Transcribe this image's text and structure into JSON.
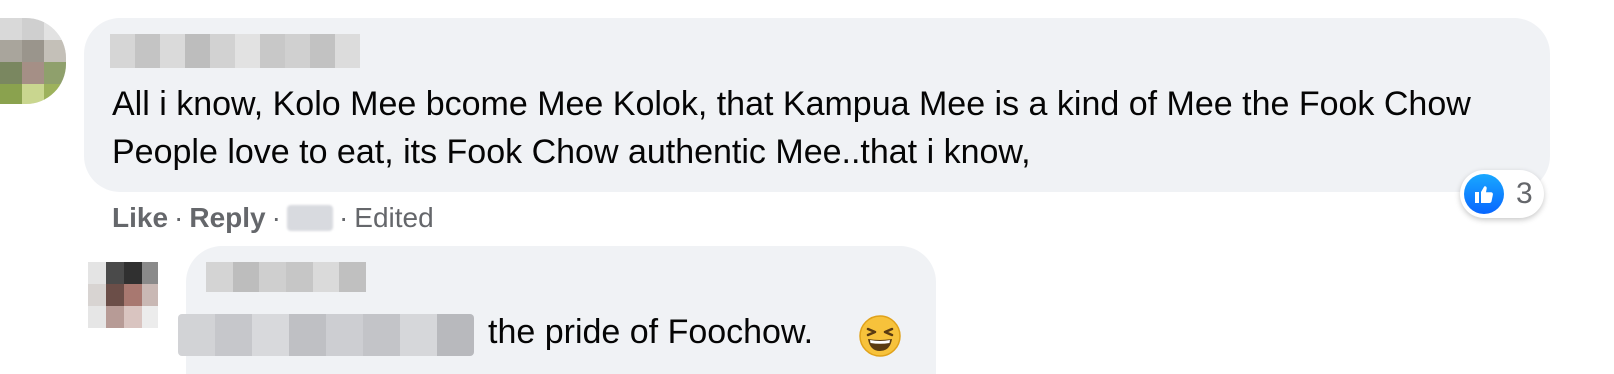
{
  "comment": {
    "text": "All i know, Kolo Mee bcome Mee Kolok, that Kampua Mee is a kind of Mee the Fook Chow People love to eat, its Fook Chow authentic Mee..that i know,",
    "actions": {
      "like": "Like",
      "reply": "Reply",
      "edited": "Edited"
    },
    "reaction": {
      "icon": "like-icon",
      "count": "3",
      "color": "#0866ff"
    }
  },
  "reply": {
    "text": "the pride of Foochow.",
    "emoji": "grinning-squinting-face-icon"
  },
  "colors": {
    "bubble": "#f0f2f5",
    "meta_text": "#65676b",
    "body_text": "#050505"
  }
}
